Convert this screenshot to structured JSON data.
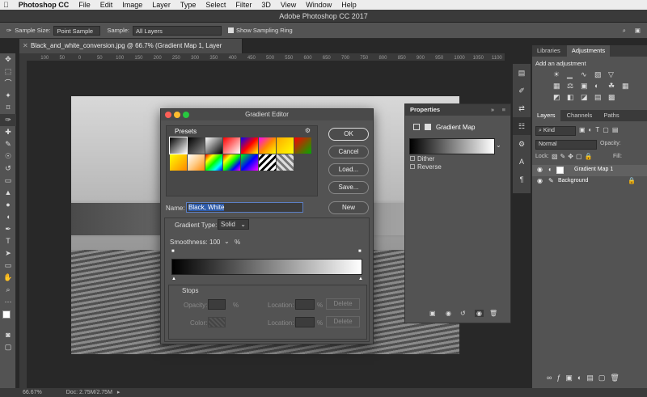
{
  "mac_menu": {
    "app": "Photoshop CC",
    "items": [
      "File",
      "Edit",
      "Image",
      "Layer",
      "Type",
      "Select",
      "Filter",
      "3D",
      "View",
      "Window",
      "Help"
    ]
  },
  "window_title": "Adobe Photoshop CC 2017",
  "options_bar": {
    "sample_size_label": "Sample Size:",
    "sample_size_value": "Point Sample",
    "sample_label": "Sample:",
    "sample_value": "All Layers",
    "show_ring": "Show Sampling Ring"
  },
  "document_tab": "Black_and_white_conversion.jpg @ 66.7% (Gradient Map 1, Layer Mask/8) *",
  "ruler_ticks": [
    "100",
    "50",
    "0",
    "50",
    "100",
    "150",
    "200",
    "250",
    "300",
    "350",
    "400",
    "450",
    "500",
    "550",
    "600",
    "650",
    "700",
    "750",
    "800",
    "850",
    "900",
    "950",
    "1000",
    "1050",
    "1100",
    "1150",
    "1200",
    "1300"
  ],
  "status": {
    "zoom": "66.67%",
    "doc": "Doc: 2.75M/2.75M"
  },
  "gradient_editor": {
    "title": "Gradient Editor",
    "presets_label": "Presets",
    "buttons": {
      "ok": "OK",
      "cancel": "Cancel",
      "load": "Load...",
      "save": "Save...",
      "new": "New"
    },
    "name_label": "Name:",
    "name_value": "Black, White",
    "gradient_type_label": "Gradient Type:",
    "gradient_type_value": "Solid",
    "smoothness_label": "Smoothness:",
    "smoothness_value": "100",
    "percent": "%",
    "stops_label": "Stops",
    "opacity_label": "Opacity:",
    "color_label": "Color:",
    "location_label": "Location:",
    "delete_label": "Delete"
  },
  "properties": {
    "title": "Properties",
    "heading": "Gradient Map",
    "dither": "Dither",
    "reverse": "Reverse"
  },
  "right_panel": {
    "tabs_top": [
      "Libraries",
      "Adjustments"
    ],
    "add_adjustment": "Add an adjustment",
    "tabs_layers": [
      "Layers",
      "Channels",
      "Paths"
    ],
    "kind": "Kind",
    "blend_mode": "Normal",
    "opacity_label": "Opacity:",
    "fill_label": "Fill:",
    "lock_label": "Lock:",
    "layers": [
      "Gradient Map 1",
      "Background"
    ]
  }
}
